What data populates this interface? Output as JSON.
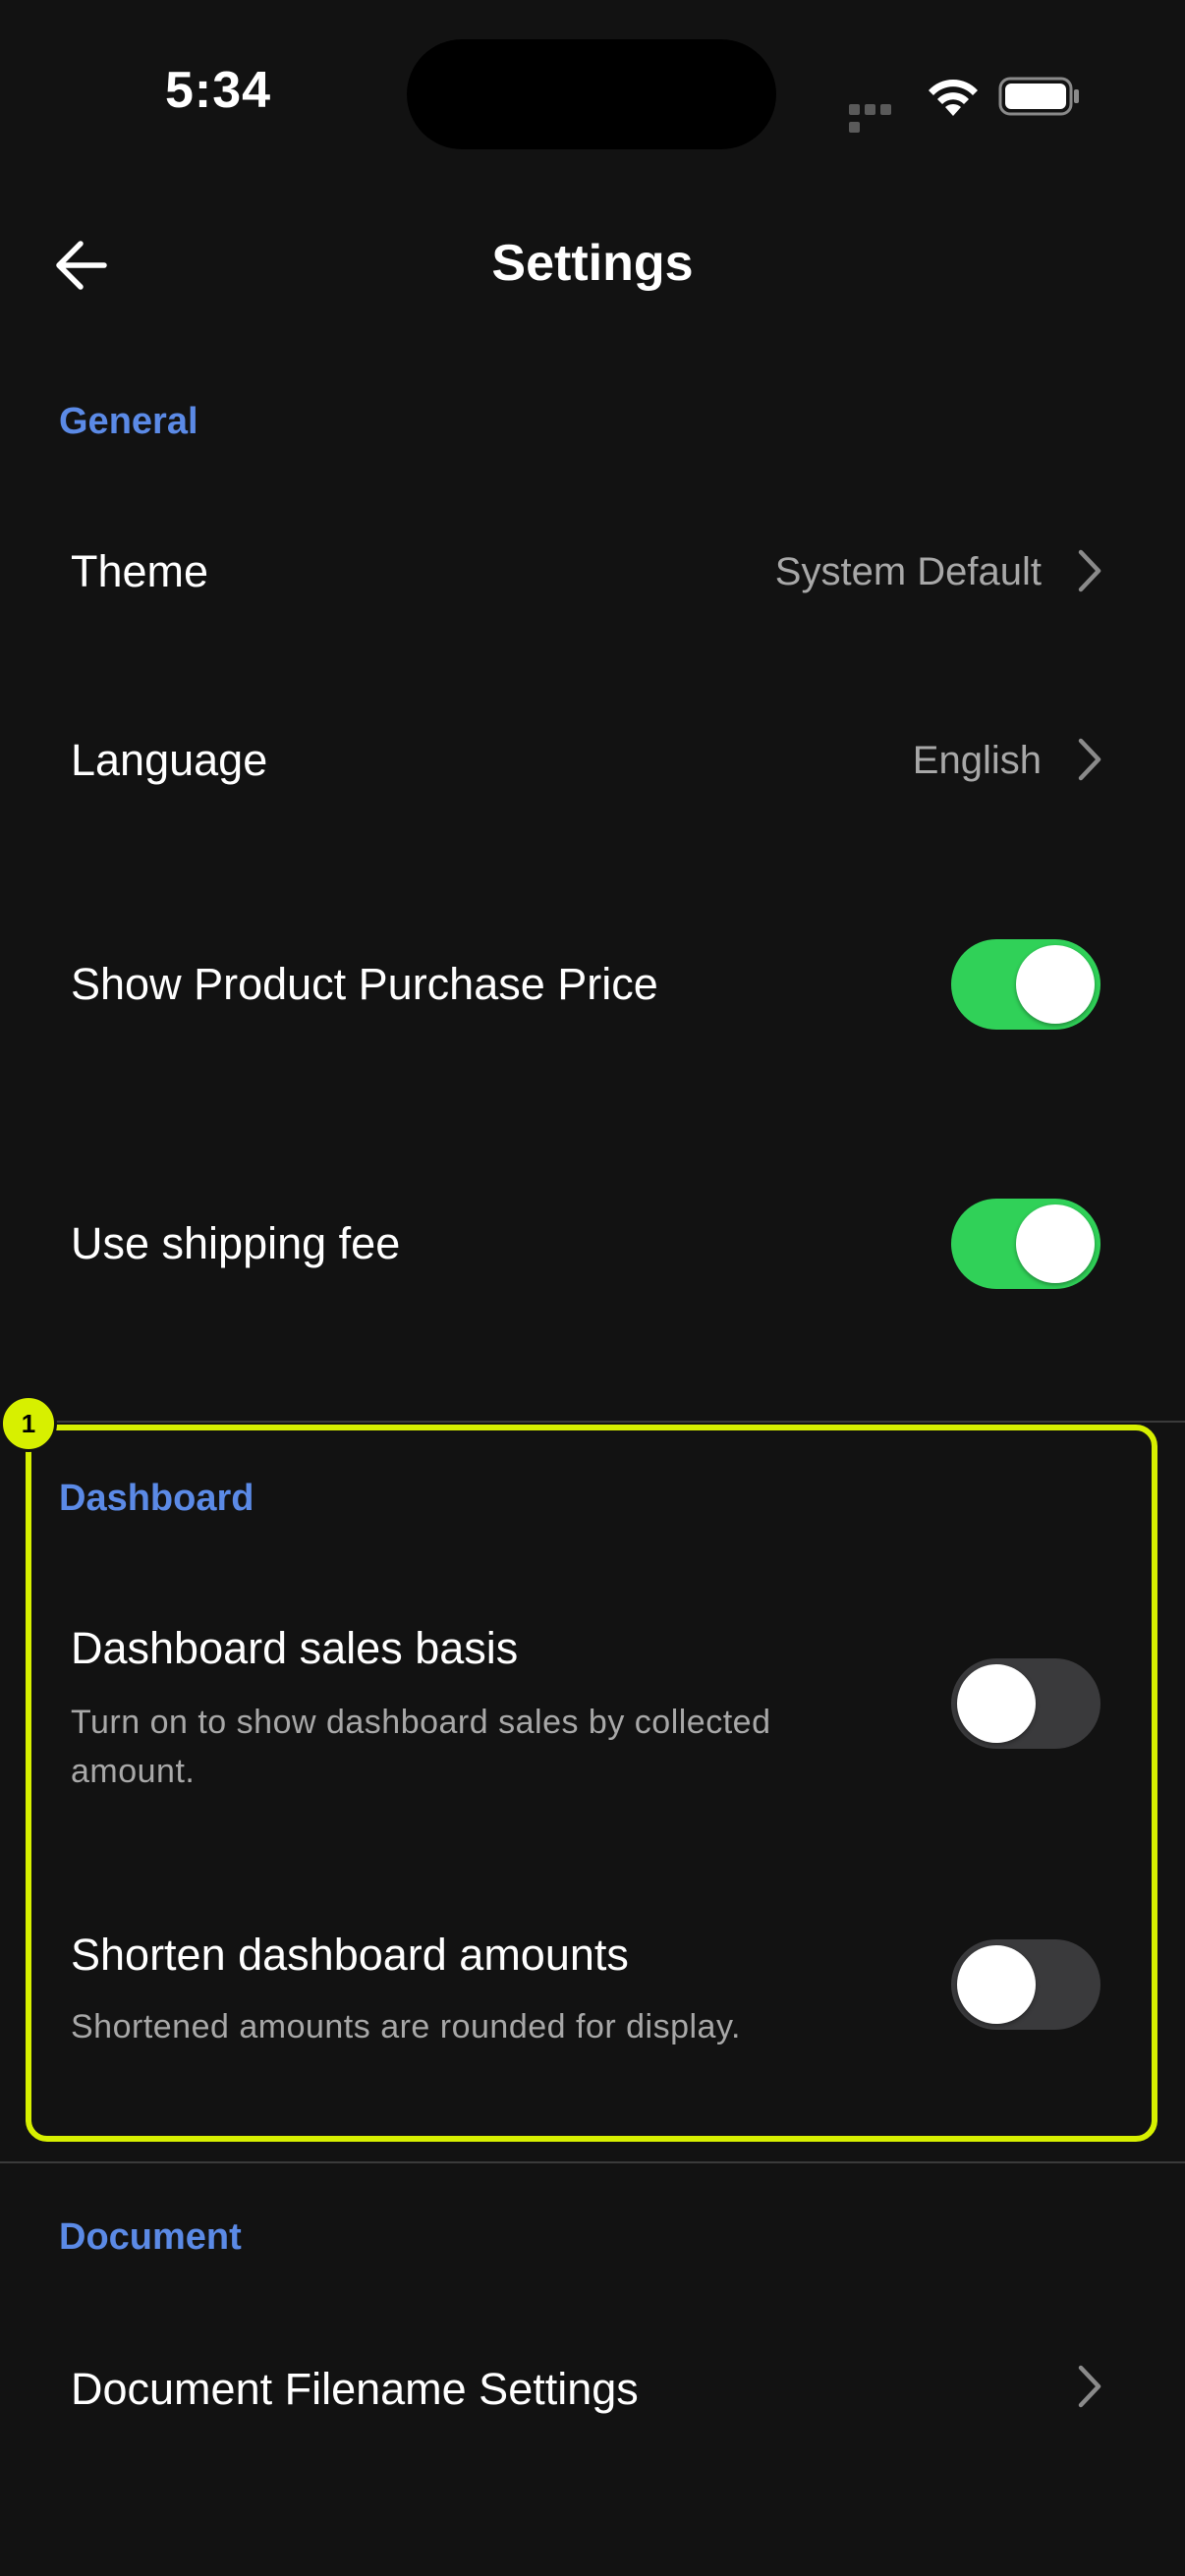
{
  "status_bar": {
    "time": "5:34"
  },
  "header": {
    "title": "Settings",
    "back_icon": "arrow-left-icon"
  },
  "sections": {
    "general": {
      "title": "General",
      "theme": {
        "label": "Theme",
        "value": "System Default"
      },
      "language": {
        "label": "Language",
        "value": "English"
      },
      "purchase_price": {
        "label": "Show Product Purchase Price",
        "enabled": true
      },
      "shipping_fee": {
        "label": "Use shipping fee",
        "enabled": true
      }
    },
    "dashboard": {
      "title": "Dashboard",
      "sales_basis": {
        "label": "Dashboard sales basis",
        "description": "Turn on to show dashboard sales by collected amount.",
        "enabled": false
      },
      "shorten_amounts": {
        "label": "Shorten dashboard amounts",
        "description": "Shortened amounts are rounded for display.",
        "enabled": false
      }
    },
    "document": {
      "title": "Document",
      "filename_settings": {
        "label": "Document Filename Settings"
      }
    }
  },
  "annotation": {
    "marker_label": "1",
    "highlight_color": "#d7f000"
  },
  "colors": {
    "background": "#121212",
    "section_accent": "#5b8ae6",
    "toggle_on": "#30d158",
    "toggle_off": "#3a3a3c"
  }
}
